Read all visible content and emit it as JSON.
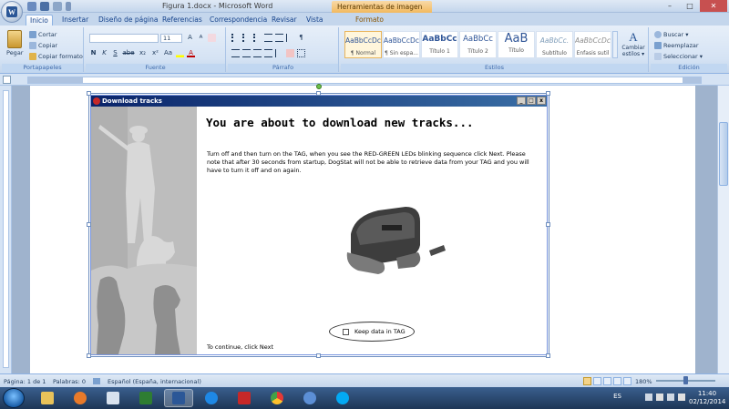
{
  "window": {
    "title": "Figura 1.docx - Microsoft Word",
    "context_tab_title": "Herramientas de imagen",
    "minimize": "–",
    "maximize": "□",
    "close": "✕"
  },
  "tabs": [
    "Inicio",
    "Insertar",
    "Diseño de página",
    "Referencias",
    "Correspondencia",
    "Revisar",
    "Vista",
    "Formato"
  ],
  "ribbon": {
    "clipboard": {
      "label": "Portapapeles",
      "paste": "Pegar",
      "cut": "Cortar",
      "copy": "Copiar",
      "format_painter": "Copiar formato"
    },
    "font": {
      "label": "Fuente",
      "font_name": "",
      "font_size": "11",
      "bold": "N",
      "italic": "K",
      "underline": "S",
      "strike": "abe",
      "subscript": "x₂",
      "superscript": "x²",
      "case": "Aa",
      "grow": "A",
      "shrink": "A",
      "color": "A"
    },
    "paragraph": {
      "label": "Párrafo"
    },
    "styles": {
      "label": "Estilos",
      "items": [
        {
          "sample": "AaBbCcDc",
          "name": "¶ Normal"
        },
        {
          "sample": "AaBbCcDc",
          "name": "¶ Sin espa..."
        },
        {
          "sample": "AaBbCc",
          "name": "Título 1"
        },
        {
          "sample": "AaBbCc",
          "name": "Título 2"
        },
        {
          "sample": "AaB",
          "name": "Título"
        },
        {
          "sample": "AaBbCc.",
          "name": "Subtítulo"
        },
        {
          "sample": "AaBbCcDc",
          "name": "Énfasis sutil"
        }
      ],
      "change_styles_line1": "Cambiar",
      "change_styles_line2": "estilos ▾"
    },
    "editing": {
      "label": "Edición",
      "find": "Buscar ▾",
      "replace": "Reemplazar",
      "select": "Seleccionar ▾"
    }
  },
  "dialog": {
    "title": "Download tracks",
    "heading": "You are about to download new tracks...",
    "body": "Turn off and then turn on the TAG, when you see the RED-GREEN LEDs blinking sequence click Next. Please note that after 30 seconds from startup, DogStat will not be able to retrieve data from your TAG and you will have to turn it off and on again.",
    "checkbox_label": "Keep data in TAG",
    "footer": "To continue, click Next"
  },
  "statusbar": {
    "page": "Página: 1 de 1",
    "words": "Palabras: 0",
    "language": "Español (España, internacional)",
    "zoom": "180%"
  },
  "taskbar": {
    "language": "ES",
    "time": "11:40",
    "date": "02/12/2014"
  },
  "colors": {
    "dialog_titlebar": "#0a246a",
    "ribbon": "#d5e3f4",
    "taskbar": "#1d3656"
  }
}
